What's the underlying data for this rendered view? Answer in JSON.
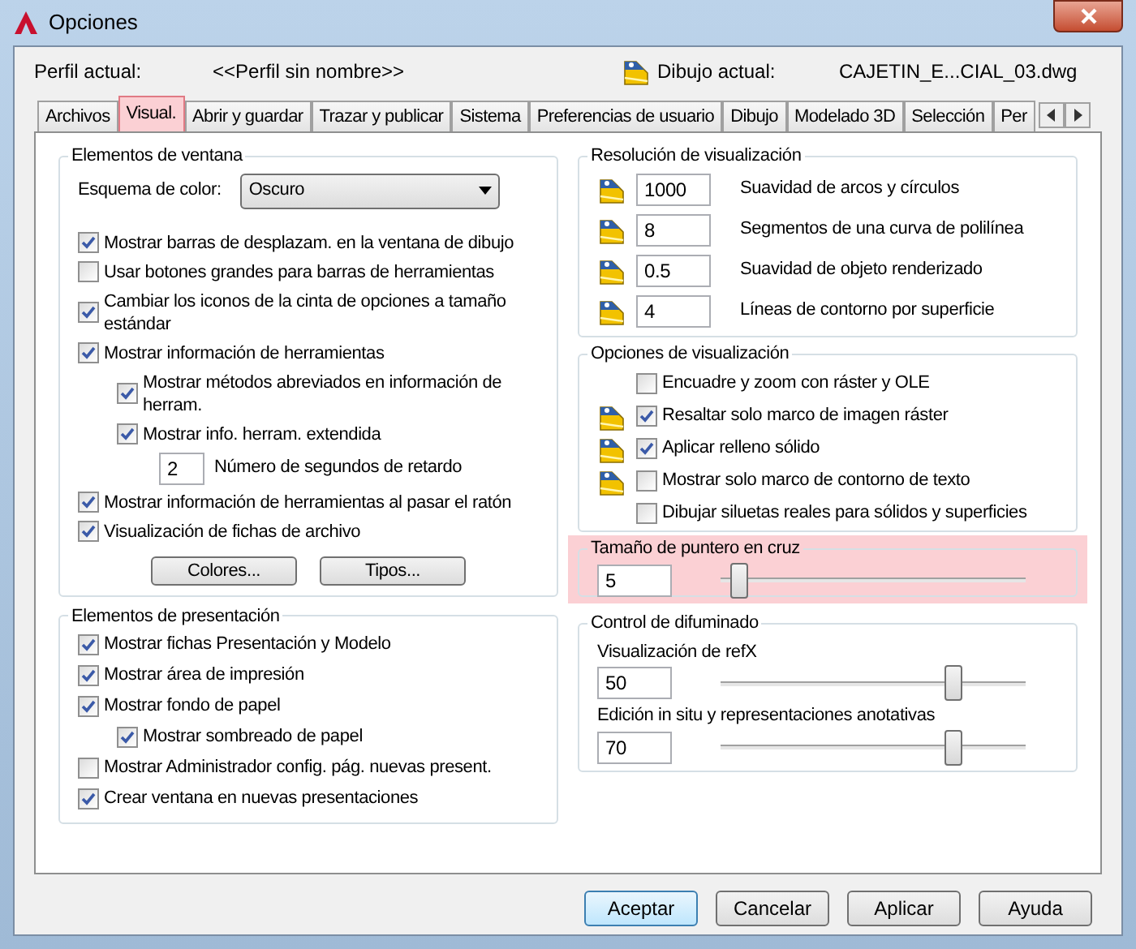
{
  "window": {
    "title": "Opciones"
  },
  "header": {
    "profile_label": "Perfil actual:",
    "profile_value": "<<Perfil sin nombre>>",
    "drawing_label": "Dibujo actual:",
    "drawing_value": "CAJETIN_E...CIAL_03.dwg"
  },
  "tabs": [
    {
      "label": "Archivos",
      "selected": false
    },
    {
      "label": "Visual.",
      "selected": true
    },
    {
      "label": "Abrir y guardar",
      "selected": false
    },
    {
      "label": "Trazar y publicar",
      "selected": false
    },
    {
      "label": "Sistema",
      "selected": false
    },
    {
      "label": "Preferencias de usuario",
      "selected": false
    },
    {
      "label": "Dibujo",
      "selected": false
    },
    {
      "label": "Modelado 3D",
      "selected": false
    },
    {
      "label": "Selección",
      "selected": false
    },
    {
      "label": "Per",
      "selected": false
    }
  ],
  "window_elements": {
    "title": "Elementos de ventana",
    "color_scheme_label": "Esquema de color:",
    "color_scheme_value": "Oscuro",
    "items": [
      {
        "kind": "checkbox",
        "label": "Mostrar barras de desplazam. en la ventana de dibujo",
        "checked": true
      },
      {
        "kind": "checkbox",
        "label": "Usar botones grandes para barras de herramientas",
        "checked": false
      },
      {
        "kind": "checkbox",
        "label": "Cambiar los iconos de la cinta de opciones a tamaño estándar",
        "checked": true
      },
      {
        "kind": "checkbox",
        "label": "Mostrar información de herramientas",
        "checked": true,
        "children": [
          {
            "kind": "checkbox",
            "label": "Mostrar métodos abreviados en información de herram.",
            "checked": true
          },
          {
            "kind": "checkbox",
            "label": "Mostrar info. herram. extendida",
            "checked": true,
            "children": [
              {
                "kind": "number",
                "value": "2",
                "label": "Número de segundos de retardo"
              }
            ]
          }
        ]
      },
      {
        "kind": "checkbox",
        "label": "Mostrar información de herramientas al pasar el ratón",
        "checked": true
      },
      {
        "kind": "checkbox",
        "label": "Visualización de fichas de archivo",
        "checked": true
      }
    ],
    "buttons": [
      "Colores...",
      "Tipos..."
    ]
  },
  "layout_elements": {
    "title": "Elementos de presentación",
    "items": [
      {
        "kind": "checkbox",
        "label": "Mostrar fichas Presentación y Modelo",
        "checked": true
      },
      {
        "kind": "checkbox",
        "label": "Mostrar área de impresión",
        "checked": true
      },
      {
        "kind": "checkbox",
        "label": "Mostrar fondo de papel",
        "checked": true,
        "children": [
          {
            "kind": "checkbox",
            "label": "Mostrar sombreado de papel",
            "checked": true
          }
        ]
      },
      {
        "kind": "checkbox",
        "label": "Mostrar Administrador config. pág. nuevas present.",
        "checked": false
      },
      {
        "kind": "checkbox",
        "label": "Crear ventana en nuevas presentaciones",
        "checked": true
      }
    ]
  },
  "display_resolution": {
    "title": "Resolución de visualización",
    "rows": [
      {
        "value": "1000",
        "label": "Suavidad de arcos y círculos"
      },
      {
        "value": "8",
        "label": "Segmentos de una curva de polilínea"
      },
      {
        "value": "0.5",
        "label": "Suavidad de objeto renderizado"
      },
      {
        "value": "4",
        "label": "Líneas de contorno por superficie"
      }
    ]
  },
  "display_options": {
    "title": "Opciones de visualización",
    "items": [
      {
        "label": "Encuadre y zoom con ráster y OLE",
        "checked": false,
        "saved_in_drawing": false
      },
      {
        "label": "Resaltar solo marco de imagen ráster",
        "checked": true,
        "saved_in_drawing": true
      },
      {
        "label": "Aplicar relleno sólido",
        "checked": true,
        "saved_in_drawing": true
      },
      {
        "label": "Mostrar solo marco de contorno de texto",
        "checked": false,
        "saved_in_drawing": true
      },
      {
        "label": "Dibujar siluetas reales para sólidos y superficies",
        "checked": false,
        "saved_in_drawing": false
      }
    ]
  },
  "crosshair": {
    "title": "Tamaño de puntero en cruz",
    "value": "5",
    "level": 0.06,
    "highlighted": true
  },
  "fade_control": {
    "title": "Control de difuminado",
    "sliders": [
      {
        "label": "Visualización de refX",
        "value": "50",
        "level": 0.76
      },
      {
        "label": "Edición in situ y representaciones anotativas",
        "value": "70",
        "level": 0.76
      }
    ]
  },
  "buttons": [
    {
      "label": "Aceptar",
      "default": true
    },
    {
      "label": "Cancelar",
      "default": false
    },
    {
      "label": "Aplicar",
      "default": false
    },
    {
      "label": "Ayuda",
      "default": false
    }
  ]
}
